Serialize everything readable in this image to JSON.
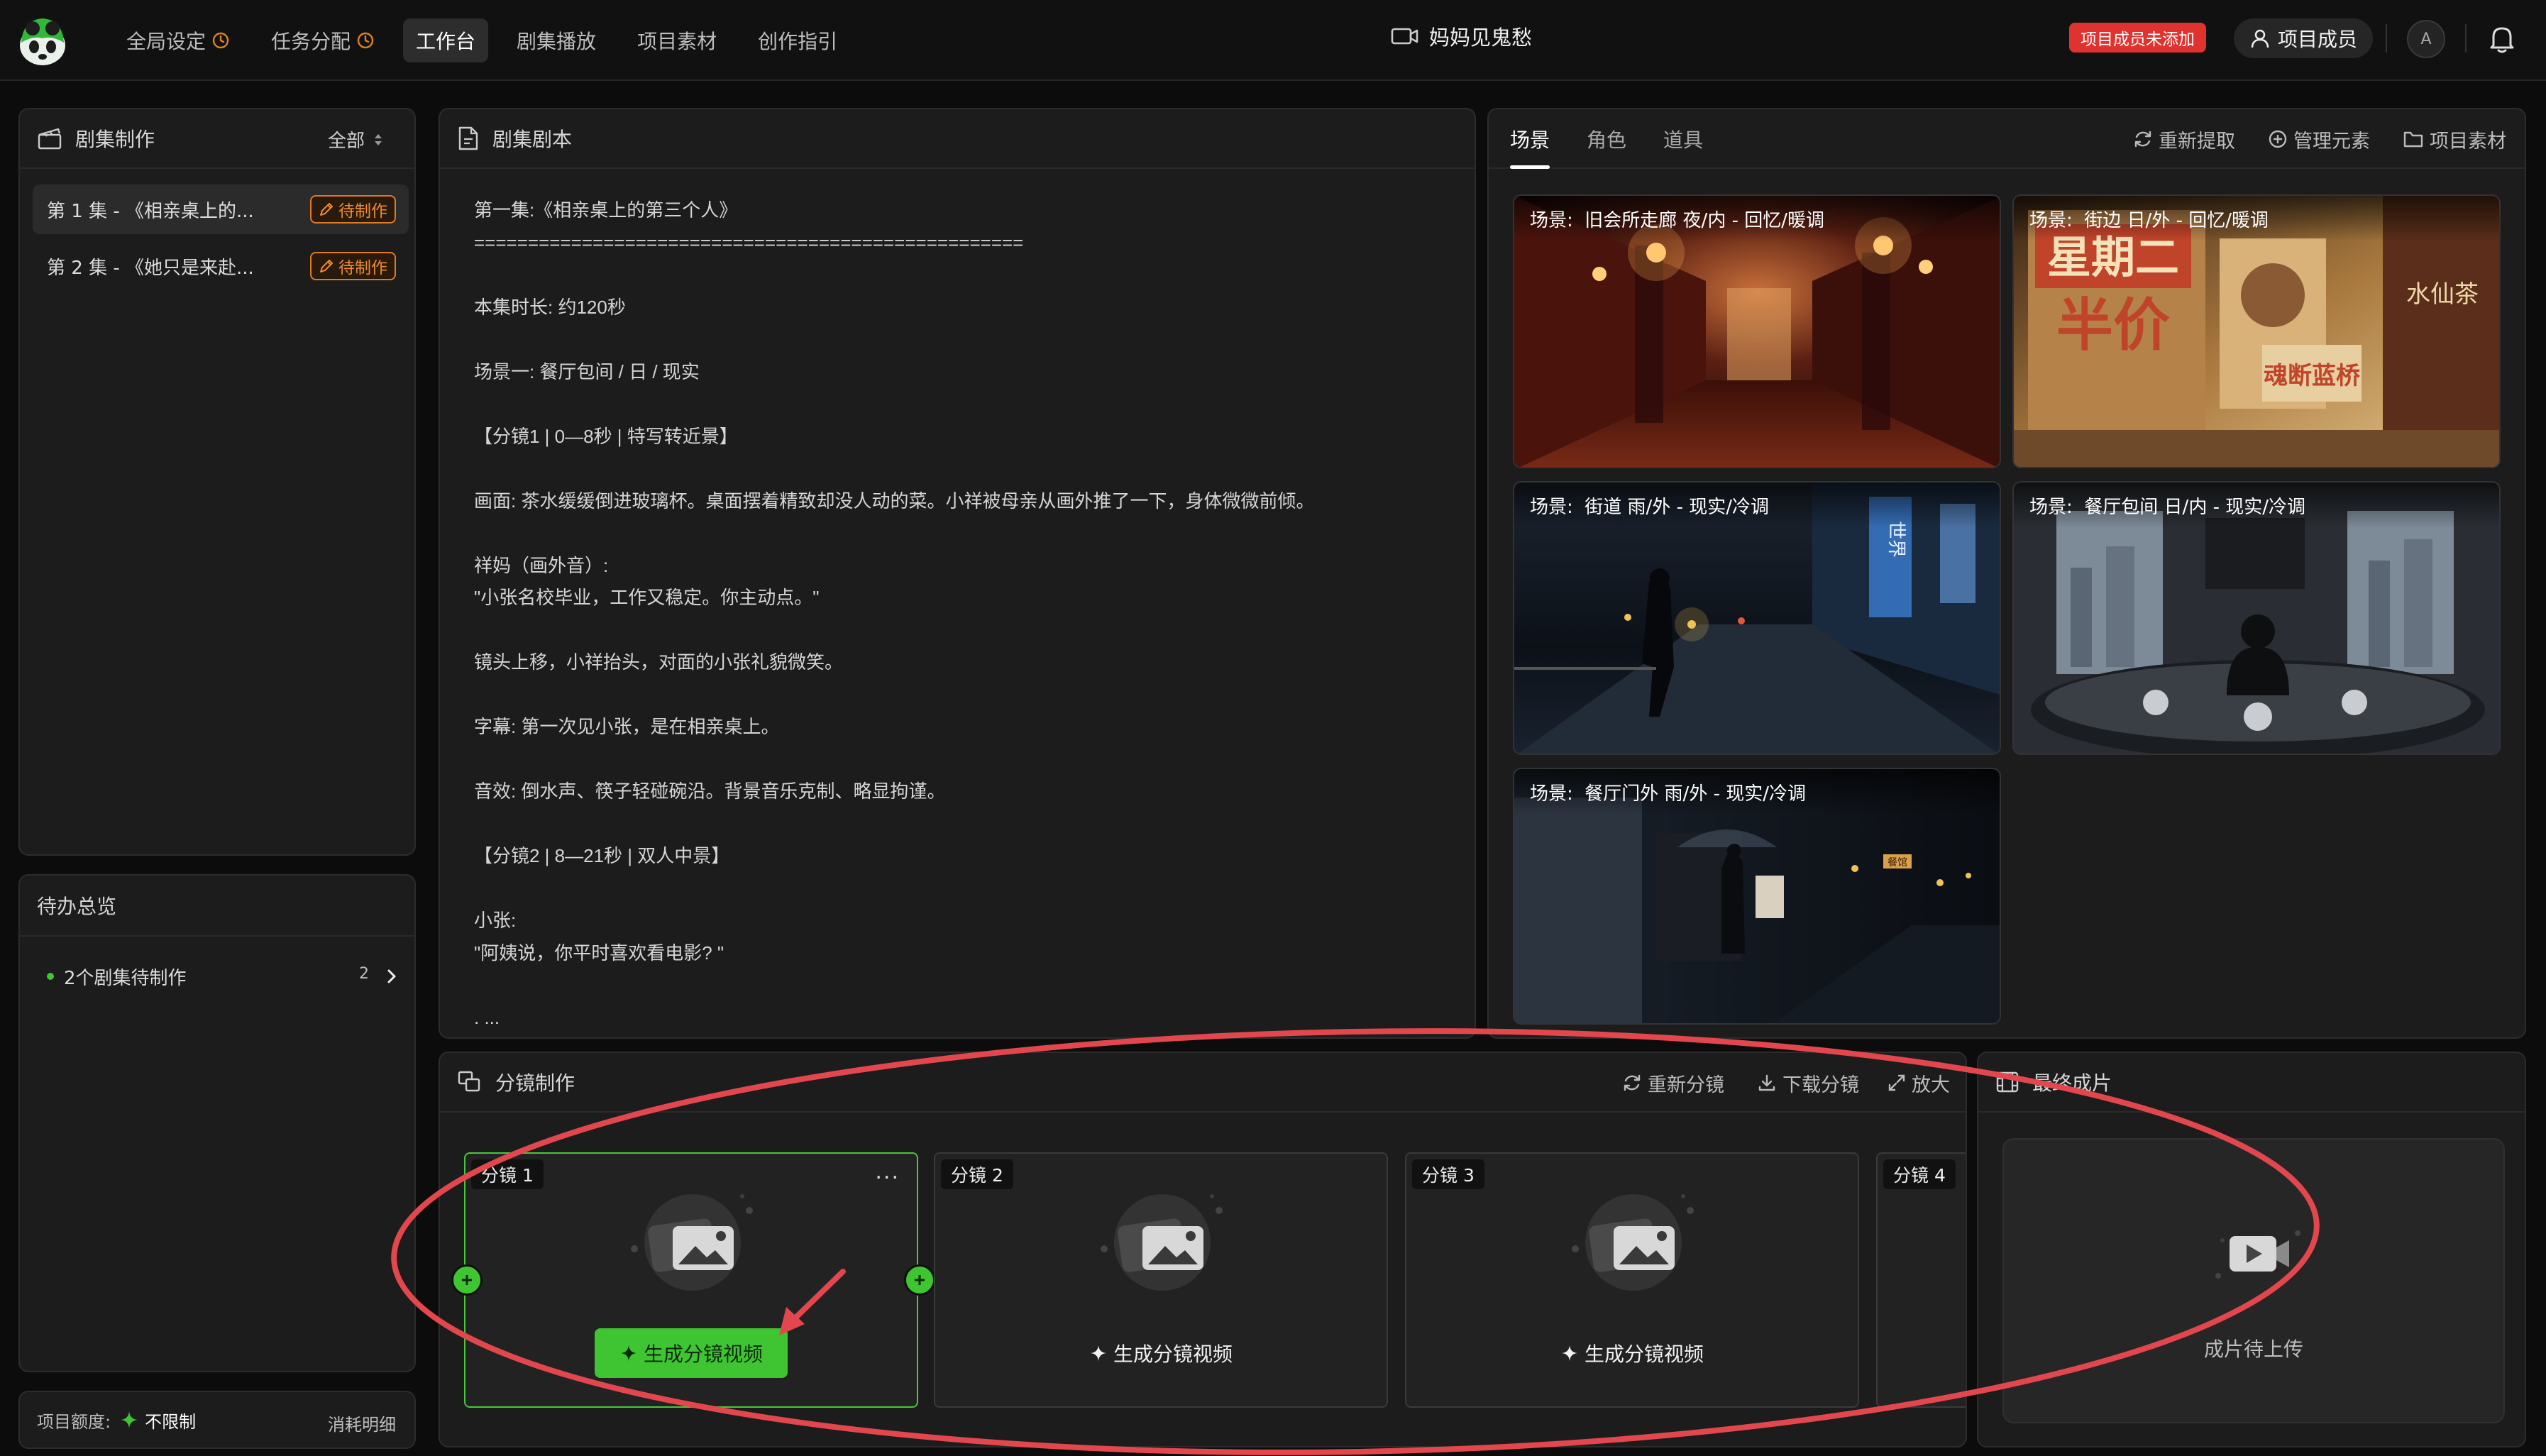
{
  "topbar": {
    "nav": [
      {
        "label": "全局设定",
        "clock": true
      },
      {
        "label": "任务分配",
        "clock": true
      },
      {
        "label": "工作台",
        "active": true
      },
      {
        "label": "剧集播放"
      },
      {
        "label": "项目素材"
      },
      {
        "label": "创作指引"
      }
    ],
    "project_title": "妈妈见鬼愁",
    "warning_tag": "项目成员未添加",
    "members_label": "项目成员",
    "avatar_letter": "A"
  },
  "episodes_panel": {
    "title": "剧集制作",
    "filter": "全部",
    "items": [
      {
        "label": "第 1 集 - 《相亲桌上的...",
        "status": "待制作"
      },
      {
        "label": "第 2 集 - 《她只是来赴...",
        "status": "待制作"
      }
    ]
  },
  "todo_panel": {
    "title": "待办总览",
    "item_label": "2个剧集待制作",
    "item_count": "2"
  },
  "quota": {
    "label": "项目额度:",
    "value": "不限制",
    "detail_link": "消耗明细"
  },
  "script_panel": {
    "title": "剧集剧本",
    "content": "第一集:《相亲桌上的第三个人》\n===================================================\n\n本集时长: 约120秒\n\n场景一: 餐厅包间 / 日 / 现实\n\n【分镜1 | 0—8秒 | 特写转近景】\n\n画面: 茶水缓缓倒进玻璃杯。桌面摆着精致却没人动的菜。小祥被母亲从画外推了一下，身体微微前倾。\n\n祥妈（画外音）:\n\"小张名校毕业，工作又稳定。你主动点。\"\n\n镜头上移，小祥抬头，对面的小张礼貌微笑。\n\n字幕: 第一次见小张，是在相亲桌上。\n\n音效: 倒水声、筷子轻碰碗沿。背景音乐克制、略显拘谨。\n\n【分镜2 | 8—21秒 | 双人中景】\n\n小张:\n\"阿姨说，你平时喜欢看电影? \"\n\n. ..."
  },
  "assets_panel": {
    "tabs": [
      "场景",
      "角色",
      "道具"
    ],
    "active_tab": "场景",
    "actions": [
      "重新提取",
      "管理元素",
      "项目素材"
    ],
    "scenes": [
      {
        "prefix": "场景:",
        "name": "旧会所走廊 夜/内 - 回忆/暖调"
      },
      {
        "prefix": "场景:",
        "name": "街边 日/外 - 回忆/暖调"
      },
      {
        "prefix": "场景:",
        "name": "街道 雨/外 - 现实/冷调"
      },
      {
        "prefix": "场景:",
        "name": "餐厅包间 日/内 - 现实/冷调"
      },
      {
        "prefix": "场景:",
        "name": "餐厅门外 雨/外 - 现实/冷调"
      }
    ],
    "scene2_signs": {
      "left1": "星期二",
      "left2": "半价",
      "right": "魂断蓝桥",
      "shop": "水仙茶"
    },
    "scene3_sign": "世界",
    "scene5_sign": "餐馆"
  },
  "storyboard_panel": {
    "title": "分镜制作",
    "actions": [
      "重新分镜",
      "下载分镜",
      "放大"
    ],
    "shots": [
      {
        "label": "分镜 1",
        "button": "生成分镜视频",
        "menu": "..."
      },
      {
        "label": "分镜 2",
        "button": "生成分镜视频"
      },
      {
        "label": "分镜 3",
        "button": "生成分镜视频"
      },
      {
        "label": "分镜 4"
      }
    ]
  },
  "final_panel": {
    "title": "最终成片",
    "placeholder": "成片待上传"
  },
  "colors": {
    "accent_green": "#3ec531",
    "warning_orange": "#f08a2a",
    "alert_red": "#e0332f",
    "annotation_red": "#e2474d"
  }
}
